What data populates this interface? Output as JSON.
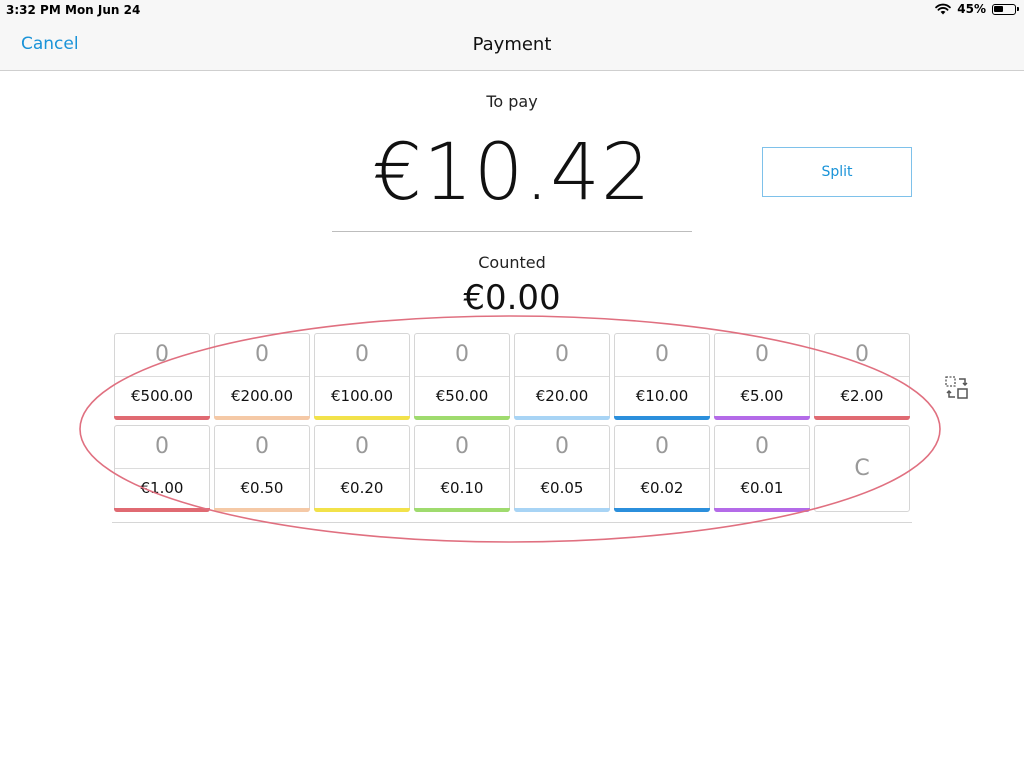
{
  "status_bar": {
    "time": "3:32 PM",
    "date": "Mon Jun 24",
    "battery": "45%"
  },
  "nav": {
    "cancel_label": "Cancel",
    "title": "Payment"
  },
  "payment": {
    "to_pay_label": "To pay",
    "amount": "€10.42",
    "split_label": "Split",
    "counted_label": "Counted",
    "counted_value": "€0.00"
  },
  "denominations": [
    {
      "count": "0",
      "label": "€500.00",
      "color": "#e06a72"
    },
    {
      "count": "0",
      "label": "€200.00",
      "color": "#f5c9a6"
    },
    {
      "count": "0",
      "label": "€100.00",
      "color": "#f2e24a"
    },
    {
      "count": "0",
      "label": "€50.00",
      "color": "#9fdb6e"
    },
    {
      "count": "0",
      "label": "€20.00",
      "color": "#a8d4f5"
    },
    {
      "count": "0",
      "label": "€10.00",
      "color": "#2b8fdc"
    },
    {
      "count": "0",
      "label": "€5.00",
      "color": "#b46be8"
    },
    {
      "count": "0",
      "label": "€2.00",
      "color": "#e06a72"
    },
    {
      "count": "0",
      "label": "€1.00",
      "color": "#e06a72"
    },
    {
      "count": "0",
      "label": "€0.50",
      "color": "#f5c9a6"
    },
    {
      "count": "0",
      "label": "€0.20",
      "color": "#f2e24a"
    },
    {
      "count": "0",
      "label": "€0.10",
      "color": "#9fdb6e"
    },
    {
      "count": "0",
      "label": "€0.05",
      "color": "#a8d4f5"
    },
    {
      "count": "0",
      "label": "€0.02",
      "color": "#2b8fdc"
    },
    {
      "count": "0",
      "label": "€0.01",
      "color": "#b46be8"
    }
  ],
  "clear_label": "C",
  "icons": {
    "wifi": "wifi-icon",
    "battery": "battery-icon",
    "swap": "swap-layout-icon"
  },
  "colors": {
    "accent": "#1a93d8",
    "annotation": "#e07080"
  }
}
